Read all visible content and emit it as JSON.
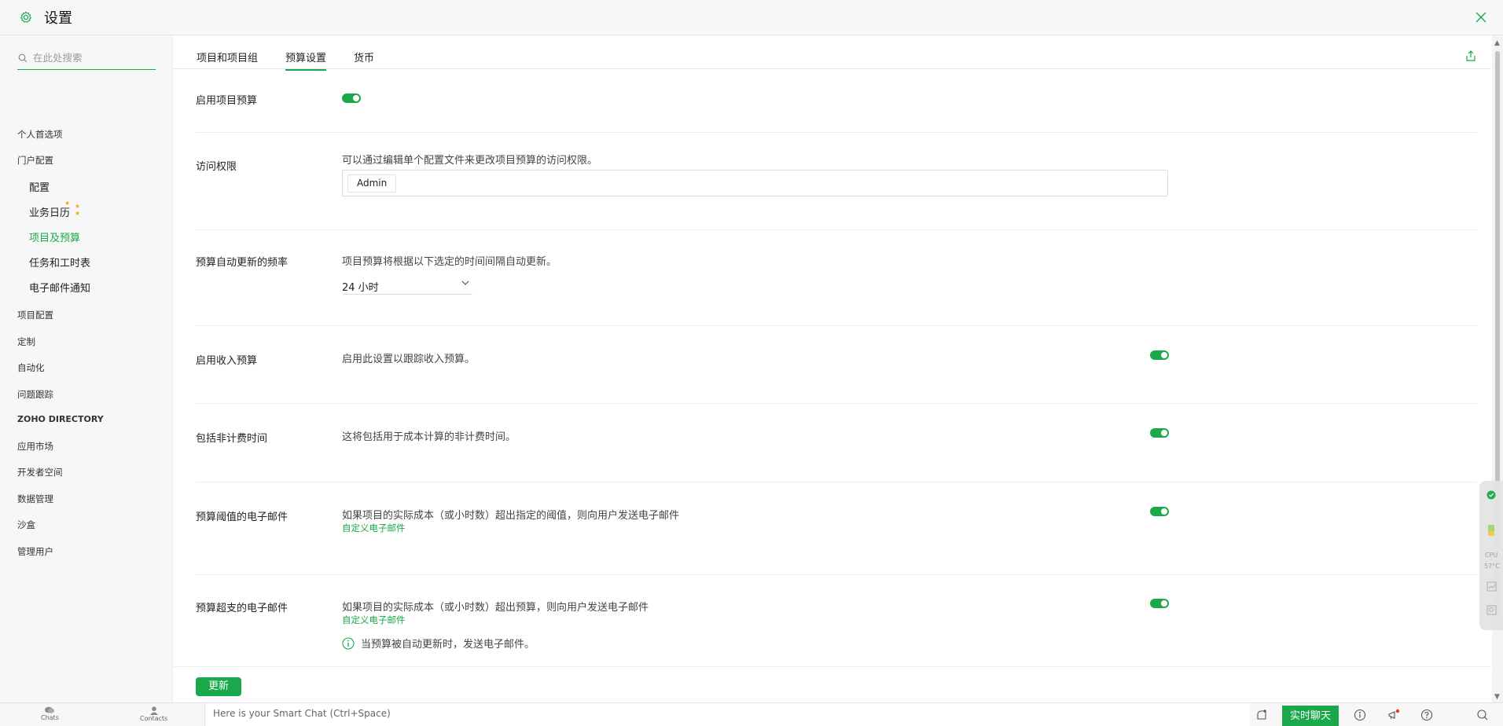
{
  "header": {
    "title": "设置"
  },
  "search": {
    "placeholder": "在此处搜索"
  },
  "sidebar": {
    "items": [
      {
        "label": "个人首选项"
      },
      {
        "label": "门户配置"
      },
      {
        "label": "配置"
      },
      {
        "label": "业务日历"
      },
      {
        "label": "项目及预算"
      },
      {
        "label": "任务和工时表"
      },
      {
        "label": "电子邮件通知"
      },
      {
        "label": "项目配置"
      },
      {
        "label": "定制"
      },
      {
        "label": "自动化"
      },
      {
        "label": "问题跟踪"
      },
      {
        "label": "ZOHO DIRECTORY"
      },
      {
        "label": "应用市场"
      },
      {
        "label": "开发者空间"
      },
      {
        "label": "数据管理"
      },
      {
        "label": "沙盒"
      },
      {
        "label": "管理用户"
      }
    ]
  },
  "tabs": [
    {
      "label": "项目和项目组"
    },
    {
      "label": "预算设置"
    },
    {
      "label": "货币"
    }
  ],
  "settings": {
    "enable_budget": {
      "label": "启用项目预算",
      "enabled": true
    },
    "access": {
      "label": "访问权限",
      "desc": "可以通过编辑单个配置文件来更改项目预算的访问权限。",
      "tag": "Admin"
    },
    "frequency": {
      "label": "预算自动更新的频率",
      "desc": "项目预算将根据以下选定的时间间隔自动更新。",
      "value": "24 小时"
    },
    "revenue": {
      "label": "启用收入预算",
      "desc": "启用此设置以跟踪收入预算。",
      "enabled": true
    },
    "nonbillable": {
      "label": "包括非计费时间",
      "desc": "这将包括用于成本计算的非计费时间。",
      "enabled": true
    },
    "threshold": {
      "label": "预算阈值的电子邮件",
      "desc": "如果项目的实际成本（或小时数）超出指定的阈值，则向用户发送电子邮件",
      "link": "自定义电子邮件",
      "enabled": true
    },
    "overrun": {
      "label": "预算超支的电子邮件",
      "desc": "如果项目的实际成本（或小时数）超出预算，则向用户发送电子邮件",
      "link": "自定义电子邮件",
      "enabled": true,
      "note": "当预算被自动更新时，发送电子邮件。"
    }
  },
  "footer": {
    "update_label": "更新"
  },
  "widget": {
    "cpu_label": "CPU",
    "temp": "57°C"
  },
  "bottombar": {
    "chats": "Chats",
    "contacts": "Contacts",
    "smart_chat_placeholder": "Here is your Smart Chat (Ctrl+Space)",
    "live_chat": "实时聊天"
  },
  "colors": {
    "accent": "#1aa84a",
    "star": "#f5a623"
  }
}
